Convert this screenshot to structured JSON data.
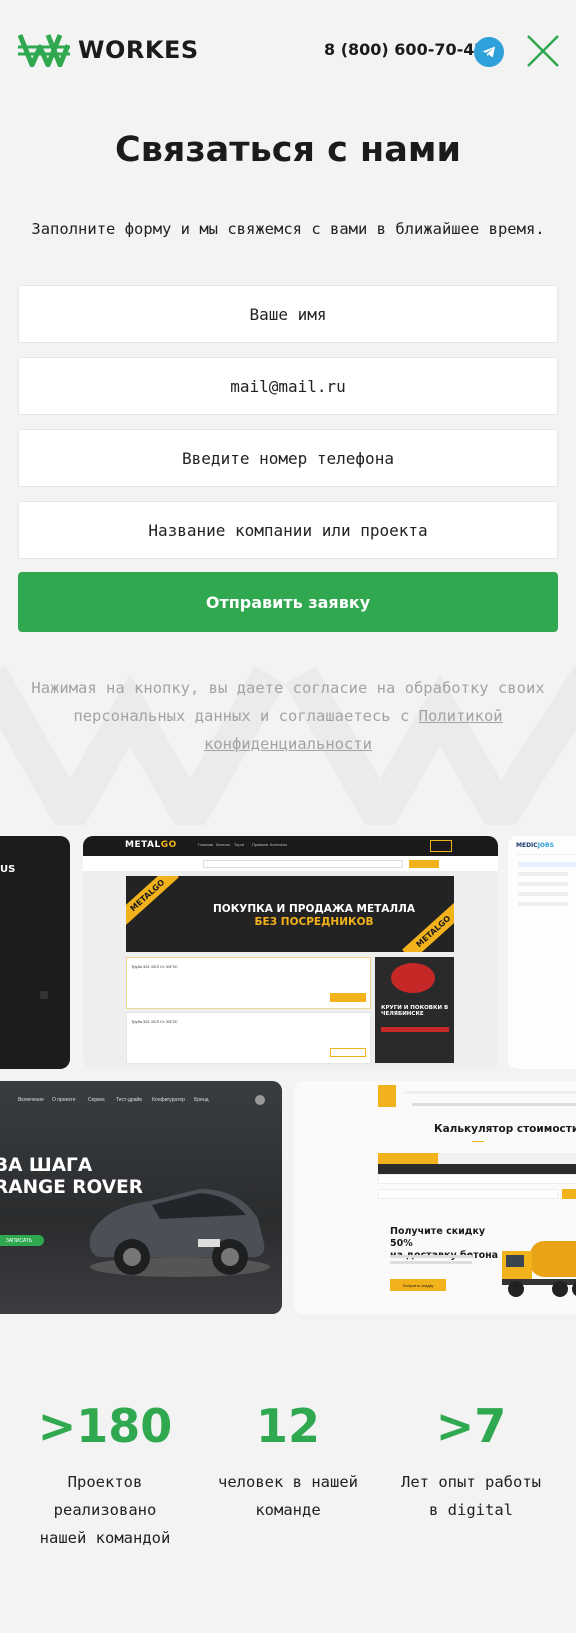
{
  "header": {
    "logo_text": "WORKES",
    "phone": "8 (800) 600-70-47"
  },
  "contact": {
    "title": "Связаться с нами",
    "subtitle": "Заполните форму и мы свяжемся с вами в ближайшее время.",
    "name_placeholder": "Ваше имя",
    "email_placeholder": "mail@mail.ru",
    "phone_placeholder": "Введите номер телефона",
    "company_placeholder": "Название компании или проекта",
    "submit_label": "Отправить заявку",
    "consent_text": "Нажимая на кнопку, вы даете согласие на обработку своих персональных данных и соглашаетесь с ",
    "consent_link": "Политикой конфиденциальности"
  },
  "portfolio": {
    "metal": {
      "logo_a": "METAL",
      "logo_b": "GO",
      "nav": [
        "Главная",
        "Каталог",
        "Торги",
        "Правила",
        "Контакты"
      ],
      "banner_line1": "ПОКУПКА И ПРОДАЖА МЕТАЛЛА",
      "banner_line2": "БЕЗ ПОСРЕДНИКОВ",
      "tag": "METALGO",
      "ad_title": "КРУГИ И ПОКОВКИ В ЧЕЛЯБИНСКЕ",
      "lot1": "Труба 324 ЭСЛ Ст 09Г2С",
      "lot2": "Труба 324 ЭСЛ Ст 09Г2С"
    },
    "dark_card_text": "US",
    "medic_logo_a": "MEDIC",
    "medic_logo_b": "JOBS",
    "car": {
      "line1": "ВА ШАГА",
      "line2": "RANGE ROVER",
      "nav": [
        "Включение",
        "О проекте",
        "Сервис",
        "Тест-драйв",
        "Конфигуратор",
        "Бренд"
      ],
      "button": "ЗАПИСАТЬ"
    },
    "concrete": {
      "calc_title": "Калькулятор стоимости",
      "promo_line1": "Получите скидку 50%",
      "promo_line2": "на доставку бетона",
      "promo_button": "Получить скидку"
    }
  },
  "stats": [
    {
      "number": ">180",
      "label_lines": [
        "Проектов",
        "реализовано",
        "нашей командой"
      ]
    },
    {
      "number": "12",
      "label_lines": [
        "человек в нашей",
        "команде"
      ]
    },
    {
      "number": ">7",
      "label_lines": [
        "Лет опыт работы",
        "в digital"
      ]
    }
  ],
  "colors": {
    "accent_green": "#2fa84f",
    "telegram_blue": "#2ea1da",
    "metal_yellow": "#f2b21b",
    "background": "#f3f3f3"
  },
  "icons": [
    "logo-icon",
    "telegram-icon",
    "close-icon"
  ]
}
